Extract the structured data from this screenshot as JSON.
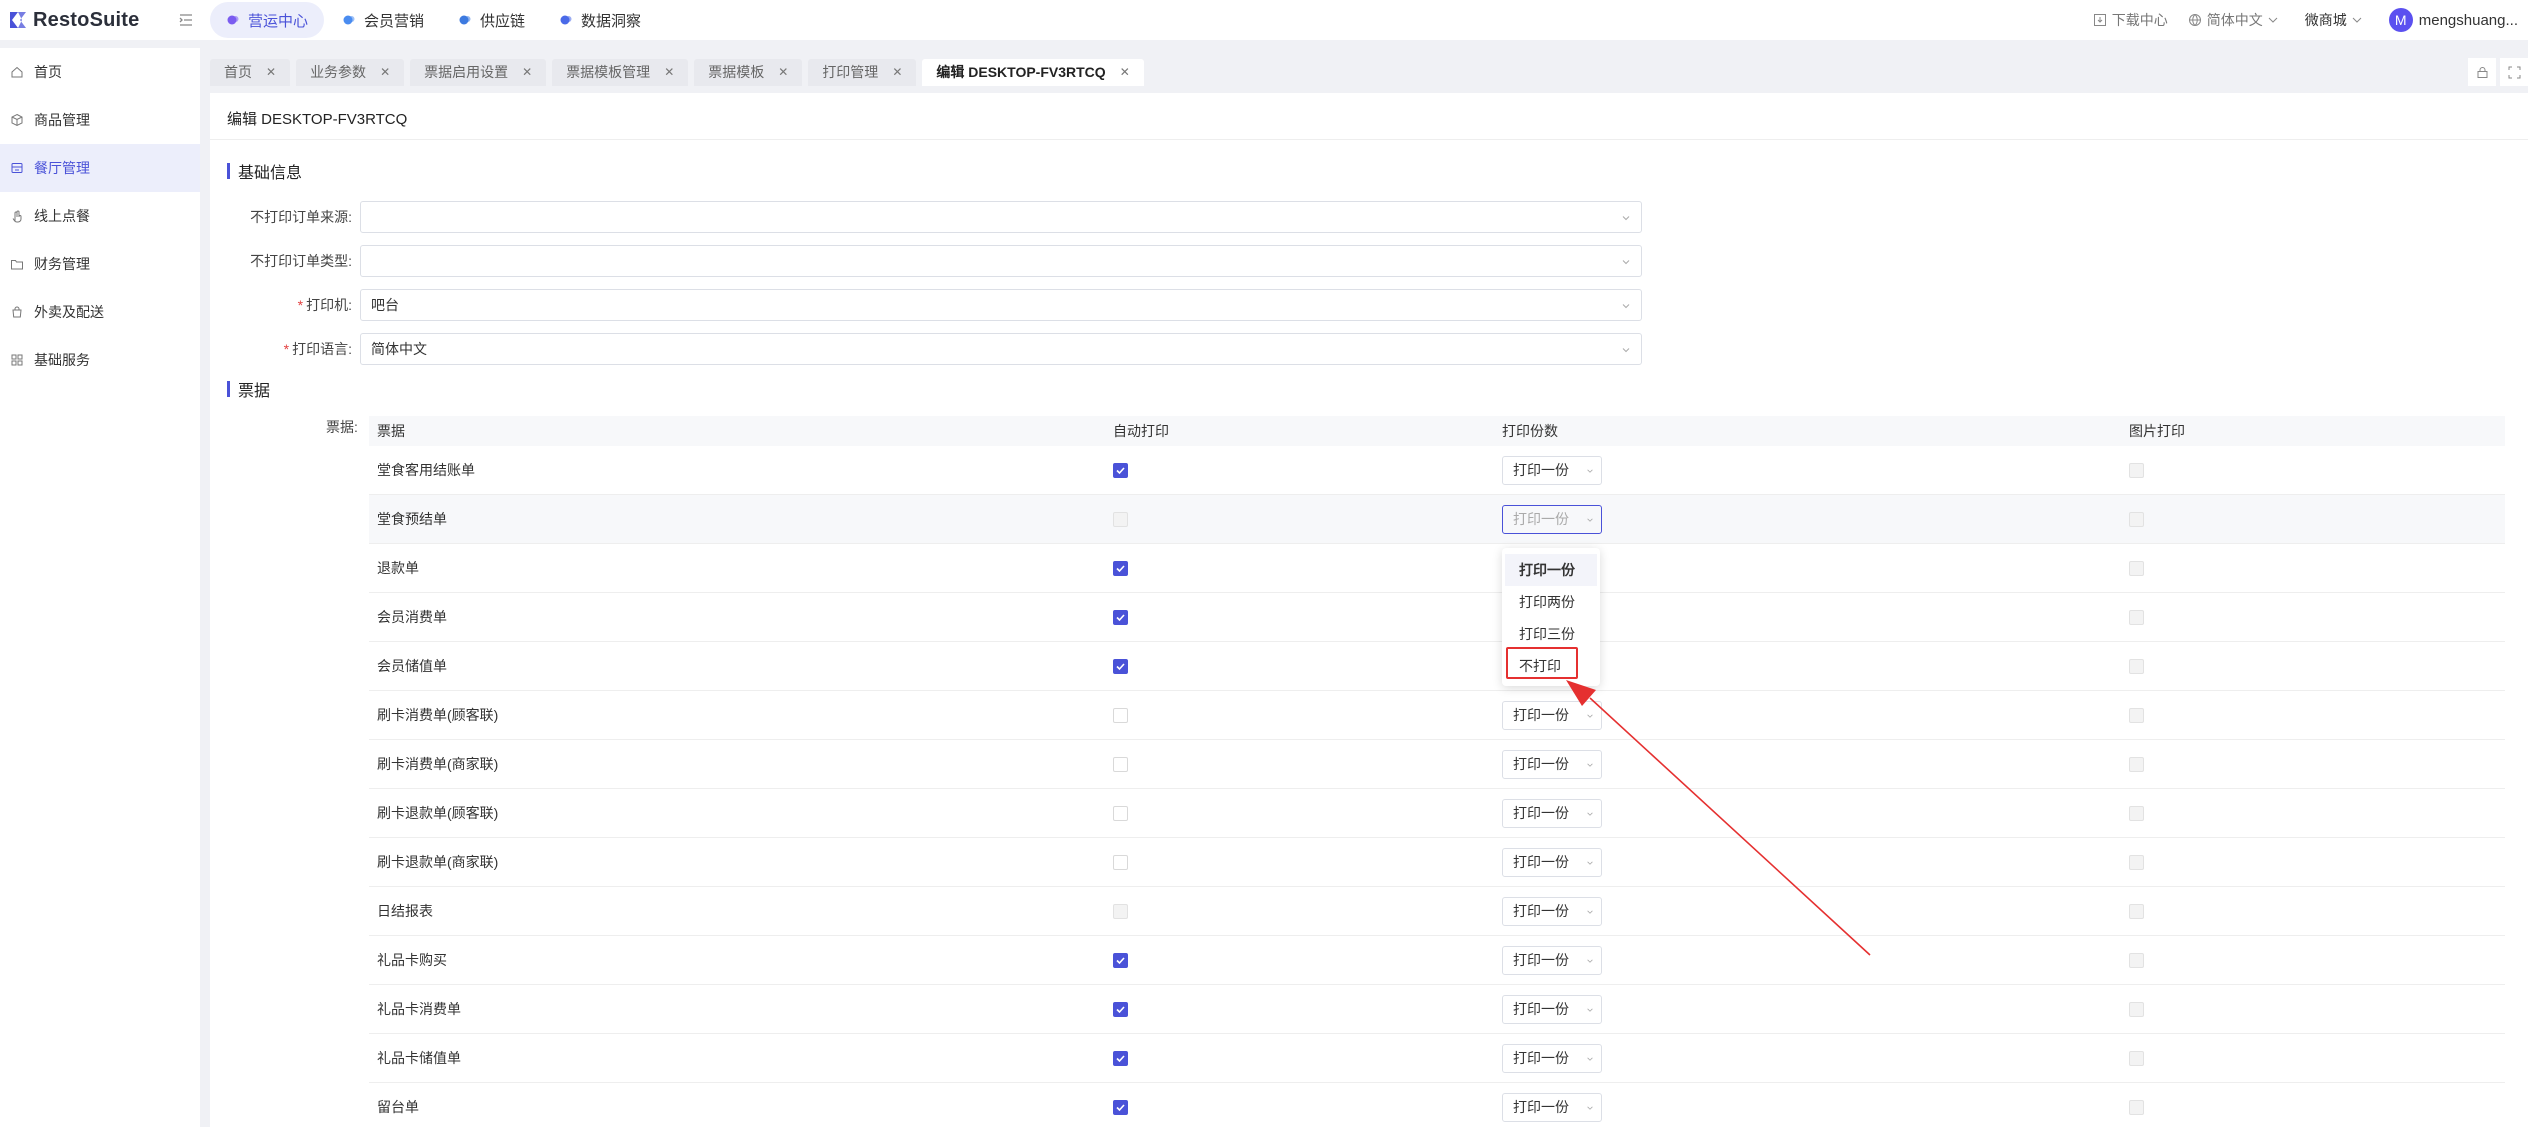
{
  "app": {
    "name": "RestoSuite"
  },
  "top_nav": [
    {
      "label": "营运中心",
      "active": true,
      "color": "#7b5cf0"
    },
    {
      "label": "会员营销",
      "active": false,
      "color": "#4a8cf0"
    },
    {
      "label": "供应链",
      "active": false,
      "color": "#3d7ae0"
    },
    {
      "label": "数据洞察",
      "active": false,
      "color": "#4a6ae8"
    }
  ],
  "top_right": {
    "download": "下载中心",
    "language": "简体中文",
    "store": "微商城",
    "avatar_initial": "M",
    "user": "mengshuang..."
  },
  "sidebar": [
    {
      "label": "首页",
      "icon": "home-icon"
    },
    {
      "label": "商品管理",
      "icon": "box-icon"
    },
    {
      "label": "餐厅管理",
      "icon": "store-icon",
      "active": true
    },
    {
      "label": "线上点餐",
      "icon": "hand-icon"
    },
    {
      "label": "财务管理",
      "icon": "folder-icon"
    },
    {
      "label": "外卖及配送",
      "icon": "bag-icon"
    },
    {
      "label": "基础服务",
      "icon": "grid-icon"
    }
  ],
  "page_tabs": [
    {
      "label": "首页"
    },
    {
      "label": "业务参数"
    },
    {
      "label": "票据启用设置"
    },
    {
      "label": "票据模板管理"
    },
    {
      "label": "票据模板"
    },
    {
      "label": "打印管理"
    },
    {
      "label": "编辑 DESKTOP-FV3RTCQ",
      "active": true
    }
  ],
  "page": {
    "title": "编辑 DESKTOP-FV3RTCQ",
    "section_basic": "基础信息",
    "section_tickets": "票据",
    "fields": [
      {
        "label": "不打印订单来源:",
        "required": false,
        "value": ""
      },
      {
        "label": "不打印订单类型:",
        "required": false,
        "value": ""
      },
      {
        "label": "打印机:",
        "required": true,
        "value": "吧台"
      },
      {
        "label": "打印语言:",
        "required": true,
        "value": "简体中文"
      }
    ],
    "table_label": "票据:",
    "columns": [
      "票据",
      "自动打印",
      "打印份数",
      "图片打印"
    ],
    "rows": [
      {
        "name": "堂食客用结账单",
        "auto": "on",
        "copies": "打印一份"
      },
      {
        "name": "堂食预结单",
        "auto": "disabled",
        "copies": "打印一份",
        "focus": true
      },
      {
        "name": "退款单",
        "auto": "on",
        "copies": ""
      },
      {
        "name": "会员消费单",
        "auto": "on",
        "copies": ""
      },
      {
        "name": "会员储值单",
        "auto": "on",
        "copies": ""
      },
      {
        "name": "刷卡消费单(顾客联)",
        "auto": "off",
        "copies": "打印一份"
      },
      {
        "name": "刷卡消费单(商家联)",
        "auto": "off",
        "copies": "打印一份"
      },
      {
        "name": "刷卡退款单(顾客联)",
        "auto": "off",
        "copies": "打印一份"
      },
      {
        "name": "刷卡退款单(商家联)",
        "auto": "off",
        "copies": "打印一份"
      },
      {
        "name": "日结报表",
        "auto": "disabled",
        "copies": "打印一份"
      },
      {
        "name": "礼品卡购买",
        "auto": "on",
        "copies": "打印一份"
      },
      {
        "name": "礼品卡消费单",
        "auto": "on",
        "copies": "打印一份"
      },
      {
        "name": "礼品卡储值单",
        "auto": "on",
        "copies": "打印一份"
      },
      {
        "name": "留台单",
        "auto": "on",
        "copies": "打印一份"
      }
    ],
    "dropdown_options": [
      "打印一份",
      "打印两份",
      "打印三份",
      "不打印"
    ]
  },
  "colors": {
    "accent": "#4a52d8",
    "annotation": "#e53030"
  }
}
